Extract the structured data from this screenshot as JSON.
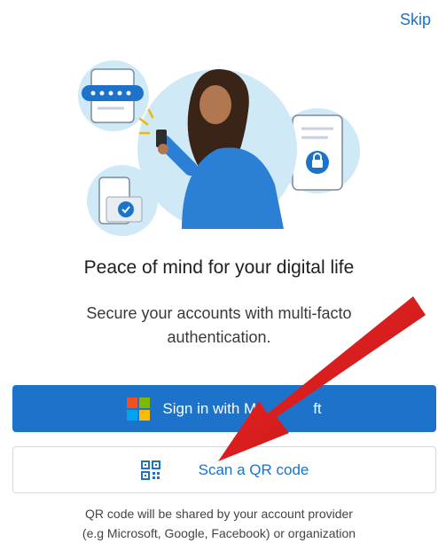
{
  "header": {
    "skip_label": "Skip"
  },
  "onboarding": {
    "title": "Peace of mind for your digital life",
    "subtitle_line1": "Secure your accounts with multi-facto",
    "subtitle_line2": "authentication."
  },
  "actions": {
    "sign_in_label": "Sign in with M",
    "sign_in_label_tail": "ft",
    "scan_qr_label": "Scan a QR code"
  },
  "footer": {
    "line1": "QR code will be shared by your account provider",
    "line2": "(e.g Microsoft, Google, Facebook) or organization"
  },
  "colors": {
    "accent": "#1d73c9",
    "arrow": "#e01b1b",
    "ms_red": "#f25022",
    "ms_green": "#7fba00",
    "ms_blue": "#00a4ef",
    "ms_yellow": "#ffb900"
  },
  "icons": [
    "microsoft-logo",
    "qr-code-icon",
    "red-arrow-annotation"
  ]
}
